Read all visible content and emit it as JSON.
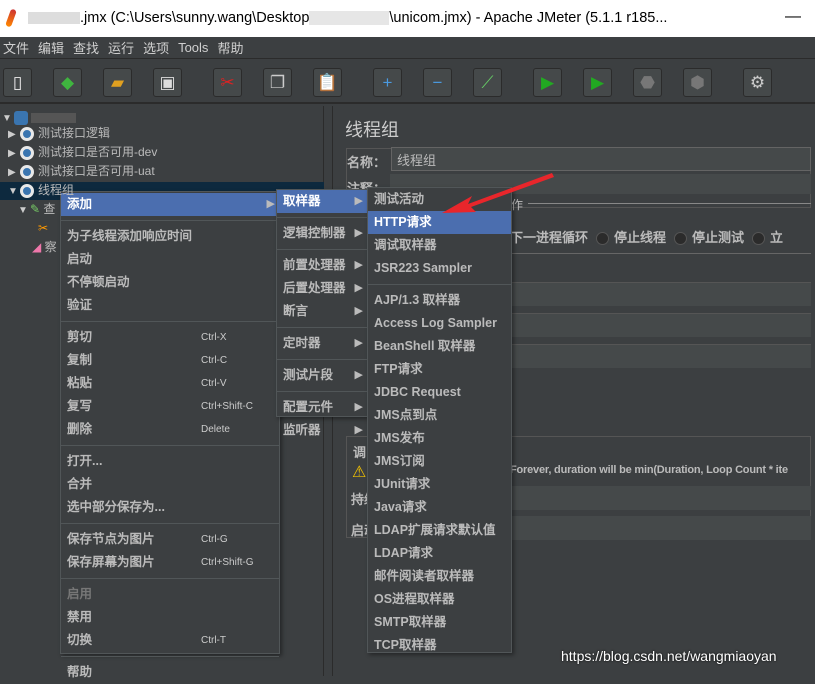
{
  "window": {
    "title_a": ".jmx (C:\\Users\\sunny.wang\\Desktop",
    "title_b": "\\unicom.jmx) - Apache JMeter (5.1.1 r185...",
    "minimize": "—"
  },
  "menubar": [
    "文件",
    "编辑",
    "查找",
    "运行",
    "选项",
    "Tools",
    "帮助"
  ],
  "toolbar": [
    {
      "icon": "new-icon",
      "g": "▯",
      "c": "#eee"
    },
    {
      "icon": "templates-icon",
      "g": "◆",
      "c": "#3fb53f"
    },
    {
      "icon": "open-icon",
      "g": "▰",
      "c": "#e0a020"
    },
    {
      "icon": "save-icon",
      "g": "▣",
      "c": "#ddd"
    },
    {
      "icon": "cut-icon",
      "g": "✂",
      "c": "#d22"
    },
    {
      "icon": "copy-icon",
      "g": "❐",
      "c": "#ccc"
    },
    {
      "icon": "paste-icon",
      "g": "📋",
      "c": "#d9a760"
    },
    {
      "icon": "expand-icon",
      "g": "+",
      "c": "#4a9ae0"
    },
    {
      "icon": "collapse-icon",
      "g": "−",
      "c": "#4a9ae0"
    },
    {
      "icon": "toggle-icon",
      "g": "⟋",
      "c": "#6c6"
    },
    {
      "icon": "start-icon",
      "g": "▶",
      "c": "#22aa22"
    },
    {
      "icon": "start-no-pause-icon",
      "g": "▶",
      "c": "#22aa22"
    },
    {
      "icon": "stop-icon",
      "g": "⬣",
      "c": "#777"
    },
    {
      "icon": "shutdown-icon",
      "g": "⬢",
      "c": "#777"
    },
    {
      "icon": "clear-icon",
      "g": "⚙",
      "c": "#ccc"
    }
  ],
  "tree": {
    "items": [
      "测试接口逻辑",
      "测试接口是否可用-dev",
      "测试接口是否可用-uat",
      "线程组"
    ],
    "child1": "查",
    "child3": "察"
  },
  "context_menu": [
    {
      "label": "添加",
      "arrow": "▶",
      "hl": true
    },
    {
      "sep": true
    },
    {
      "label": "为子线程添加响应时间"
    },
    {
      "label": "启动"
    },
    {
      "label": "不停顿启动"
    },
    {
      "label": "验证"
    },
    {
      "sep": true
    },
    {
      "label": "剪切",
      "sc": "Ctrl-X"
    },
    {
      "label": "复制",
      "sc": "Ctrl-C"
    },
    {
      "label": "粘贴",
      "sc": "Ctrl-V"
    },
    {
      "label": "复写",
      "sc": "Ctrl+Shift-C"
    },
    {
      "label": "删除",
      "sc": "Delete"
    },
    {
      "sep": true
    },
    {
      "label": "打开..."
    },
    {
      "label": "合并"
    },
    {
      "label": "选中部分保存为..."
    },
    {
      "sep": true
    },
    {
      "label": "保存节点为图片",
      "sc": "Ctrl-G"
    },
    {
      "label": "保存屏幕为图片",
      "sc": "Ctrl+Shift-G"
    },
    {
      "sep": true
    },
    {
      "label": "启用",
      "dis": true
    },
    {
      "label": "禁用"
    },
    {
      "label": "切换",
      "sc": "Ctrl-T"
    },
    {
      "sep": true
    },
    {
      "label": "帮助"
    }
  ],
  "add_menu": [
    {
      "label": "取样器",
      "arrow": "▶",
      "hl": true
    },
    {
      "sep": true
    },
    {
      "label": "逻辑控制器",
      "arrow": "▶"
    },
    {
      "sep": true
    },
    {
      "label": "前置处理器",
      "arrow": "▶"
    },
    {
      "label": "后置处理器",
      "arrow": "▶"
    },
    {
      "label": "断言",
      "arrow": "▶"
    },
    {
      "sep": true
    },
    {
      "label": "定时器",
      "arrow": "▶"
    },
    {
      "sep": true
    },
    {
      "label": "测试片段",
      "arrow": "▶"
    },
    {
      "sep": true
    },
    {
      "label": "配置元件",
      "arrow": "▶"
    },
    {
      "label": "监听器",
      "arrow": "▶"
    }
  ],
  "sampler_menu": [
    {
      "label": "测试活动"
    },
    {
      "label": "HTTP请求",
      "hl": true
    },
    {
      "label": "调试取样器"
    },
    {
      "label": "JSR223 Sampler"
    },
    {
      "sep": true
    },
    {
      "label": "AJP/1.3 取样器"
    },
    {
      "label": "Access Log Sampler"
    },
    {
      "label": "BeanShell 取样器"
    },
    {
      "label": "FTP请求"
    },
    {
      "label": "JDBC Request"
    },
    {
      "label": "JMS点到点"
    },
    {
      "label": "JMS发布"
    },
    {
      "label": "JMS订阅"
    },
    {
      "label": "JUnit请求"
    },
    {
      "label": "Java请求"
    },
    {
      "label": "LDAP扩展请求默认值"
    },
    {
      "label": "LDAP请求"
    },
    {
      "label": "邮件阅读者取样器"
    },
    {
      "label": "OS进程取样器"
    },
    {
      "label": "SMTP取样器"
    },
    {
      "label": "TCP取样器"
    }
  ],
  "panel": {
    "title": "线程组",
    "name_label": "名称：",
    "name_value": "线程组",
    "comment_label": "注释：",
    "action_legend": "作",
    "radio_a": "下一进程循环",
    "radio_b": "停止线程",
    "radio_c": "停止测试",
    "radio_d": "立",
    "sched_label": "调",
    "warning": "Forever, duration will be min(Duration, Loop Count * ite",
    "dur_label": "持续",
    "start_label": "启动"
  },
  "watermark": "https://blog.csdn.net/wangmiaoyan",
  "colors": {
    "highlight": "#4b6eaf",
    "background": "#3c3f41",
    "arrow": "#e8262b"
  }
}
